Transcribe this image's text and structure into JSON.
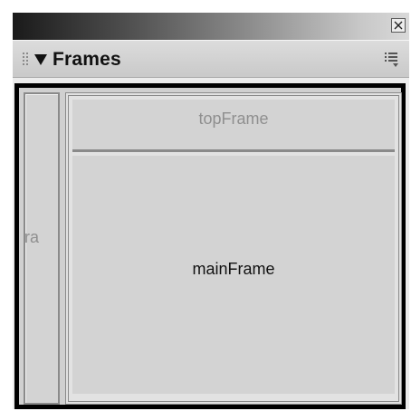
{
  "panel": {
    "close_icon": "close-x-icon",
    "collapse_icon": "triangle-down-icon",
    "title": "Frames",
    "options_icon": "panel-options-menu-icon"
  },
  "frames": {
    "left_frame_label": "Fra",
    "top_frame_label": "topFrame",
    "main_frame_label": "mainFrame"
  },
  "colors": {
    "frame_fill": "#d3d3d3",
    "frameset_border": "#000000",
    "frame_border": "#8a8a8a",
    "inactive_label": "#8f8f8f",
    "active_label": "#111111"
  }
}
